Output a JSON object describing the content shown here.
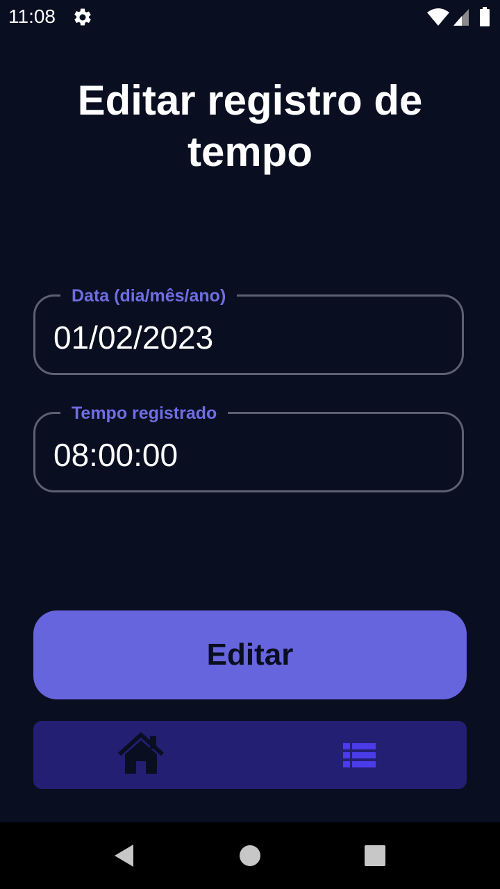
{
  "status_bar": {
    "time": "11:08",
    "icons": [
      "settings-gear-icon",
      "wifi-icon",
      "cell-signal-icon",
      "battery-icon"
    ]
  },
  "page": {
    "title": "Editar registro de tempo"
  },
  "form": {
    "date_field": {
      "label": "Data (dia/mês/ano)",
      "value": "01/02/2023"
    },
    "time_field": {
      "label": "Tempo registrado",
      "value": "08:00:00"
    }
  },
  "actions": {
    "edit_label": "Editar"
  },
  "tab_bar": {
    "tabs": [
      {
        "icon": "home-icon",
        "active": false
      },
      {
        "icon": "list-icon",
        "active": true
      }
    ]
  },
  "nav_bar": {
    "buttons": [
      "back-icon",
      "home-circle-icon",
      "recents-square-icon"
    ]
  },
  "colors": {
    "background": "#0a0e21",
    "accent": "#6765de",
    "label": "#6e6ee3",
    "tab_bar": "#231f72",
    "tab_active_icon": "#4a3ce8",
    "tab_inactive_icon": "#0a0e21",
    "field_border": "#5d6072"
  }
}
